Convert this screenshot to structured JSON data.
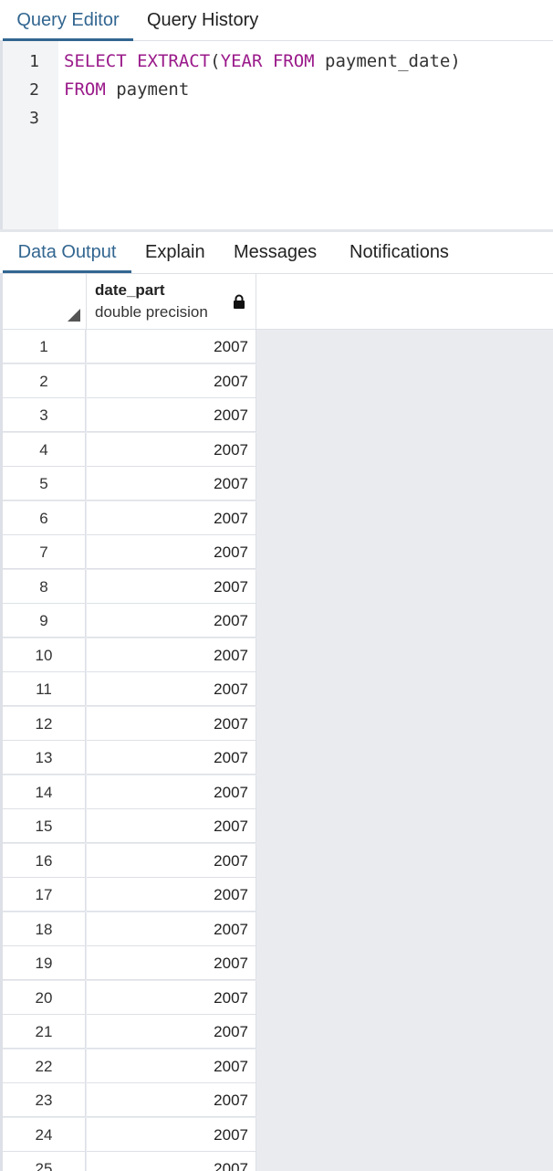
{
  "editor_tabs": [
    "Query Editor",
    "Query History"
  ],
  "editor": {
    "line_numbers": [
      "1",
      "2",
      "3"
    ],
    "line1": {
      "kw1": "SELECT",
      "kw2": "EXTRACT",
      "p1": "(",
      "kw3": "YEAR",
      "kw4": "FROM",
      "ident": " payment_date)"
    },
    "line2": {
      "kw1": "FROM",
      "ident": " payment"
    }
  },
  "output_tabs": [
    "Data Output",
    "Explain",
    "Messages",
    "Notifications"
  ],
  "grid": {
    "column": {
      "name": "date_part",
      "type": "double precision"
    },
    "lock_icon": "lock-icon",
    "rows": [
      {
        "n": "1",
        "v": "2007"
      },
      {
        "n": "2",
        "v": "2007"
      },
      {
        "n": "3",
        "v": "2007"
      },
      {
        "n": "4",
        "v": "2007"
      },
      {
        "n": "5",
        "v": "2007"
      },
      {
        "n": "6",
        "v": "2007"
      },
      {
        "n": "7",
        "v": "2007"
      },
      {
        "n": "8",
        "v": "2007"
      },
      {
        "n": "9",
        "v": "2007"
      },
      {
        "n": "10",
        "v": "2007"
      },
      {
        "n": "11",
        "v": "2007"
      },
      {
        "n": "12",
        "v": "2007"
      },
      {
        "n": "13",
        "v": "2007"
      },
      {
        "n": "14",
        "v": "2007"
      },
      {
        "n": "15",
        "v": "2007"
      },
      {
        "n": "16",
        "v": "2007"
      },
      {
        "n": "17",
        "v": "2007"
      },
      {
        "n": "18",
        "v": "2007"
      },
      {
        "n": "19",
        "v": "2007"
      },
      {
        "n": "20",
        "v": "2007"
      },
      {
        "n": "21",
        "v": "2007"
      },
      {
        "n": "22",
        "v": "2007"
      },
      {
        "n": "23",
        "v": "2007"
      },
      {
        "n": "24",
        "v": "2007"
      },
      {
        "n": "25",
        "v": "2007"
      }
    ]
  },
  "colors": {
    "accent": "#326690",
    "keyword": "#9a1a8a"
  }
}
